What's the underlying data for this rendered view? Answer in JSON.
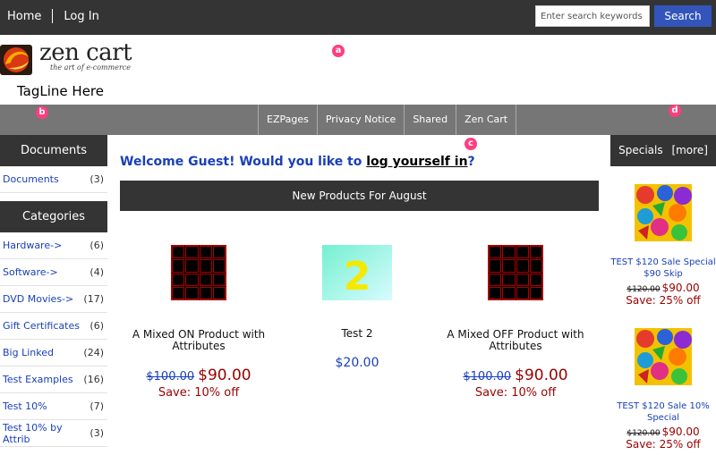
{
  "header": {
    "nav": [
      {
        "label": "Home"
      },
      {
        "label": "Log In"
      }
    ],
    "search": {
      "placeholder": "Enter search keywords here",
      "button_label": "Search"
    }
  },
  "logo": {
    "text": "zen cart",
    "subtitle": "the art of e-commerce"
  },
  "tagline": "TagLine Here",
  "markers": [
    "a",
    "b",
    "c",
    "d"
  ],
  "navbar": {
    "items": [
      "EZPages",
      "Privacy Notice",
      "Shared",
      "Zen Cart"
    ]
  },
  "sidebar": {
    "documents": {
      "title": "Documents",
      "items": [
        {
          "label": "Documents",
          "count": "(3)"
        }
      ]
    },
    "categories": {
      "title": "Categories",
      "items": [
        {
          "label": "Hardware->",
          "count": "(6)"
        },
        {
          "label": "Software->",
          "count": "(4)"
        },
        {
          "label": "DVD Movies->",
          "count": "(17)"
        },
        {
          "label": "Gift Certificates",
          "count": "(6)"
        },
        {
          "label": "Big Linked",
          "count": "(24)"
        },
        {
          "label": "Test Examples",
          "count": "(16)"
        },
        {
          "label": "Test 10%",
          "count": "(7)"
        },
        {
          "label": "Test 10% by Attrib",
          "count": "(3)"
        }
      ]
    }
  },
  "main": {
    "welcome": {
      "text": "Welcome Guest! Would you like to ",
      "link": "log yourself in",
      "end": "?"
    },
    "new_products_title": "New Products For August",
    "products": [
      {
        "name": "A Mixed ON Product with Attributes",
        "old_price": "$100.00",
        "price": "$90.00",
        "save": "Save: 10% off",
        "image": "grid"
      },
      {
        "name": "Test 2",
        "price": "$20.00",
        "image": "number-2",
        "image_text": "2"
      },
      {
        "name": "A Mixed OFF Product with Attributes",
        "old_price": "$100.00",
        "price": "$90.00",
        "save": "Save: 10% off",
        "image": "grid"
      }
    ]
  },
  "specials": {
    "title": "Specials",
    "more": "[more]",
    "items": [
      {
        "name": "TEST $120 Sale Special $90 Skip",
        "old_price": "$120.00",
        "price": "$90.00",
        "save": "Save: 25% off"
      },
      {
        "name": "TEST $120 Sale 10% Special",
        "old_price": "$120.00",
        "price": "$90.00",
        "save": "Save: 25% off"
      }
    ]
  },
  "colors": {
    "accent": "#3355bb",
    "dark_bar": "#343434",
    "nav_bar": "#767676",
    "link": "#1a40b8",
    "price": "#9b0000",
    "marker": "#ff3d7f"
  }
}
